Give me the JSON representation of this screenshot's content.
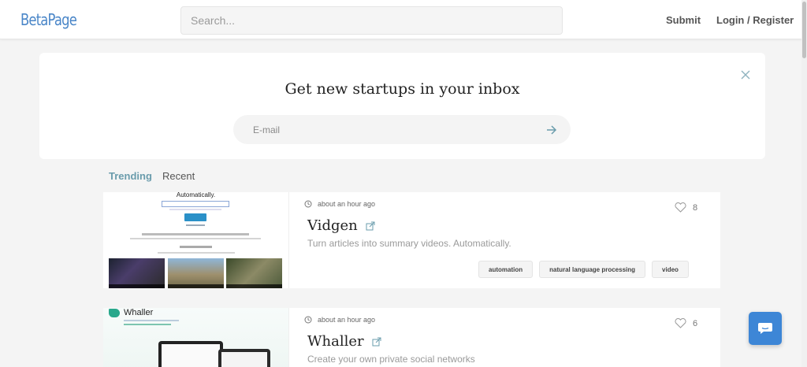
{
  "header": {
    "logo": "BetaPage",
    "search_placeholder": "Search...",
    "nav": {
      "submit": "Submit",
      "login": "Login / Register"
    }
  },
  "newsletter": {
    "title": "Get new startups in your inbox",
    "email_placeholder": "E-mail",
    "close_icon": "close-icon",
    "submit_icon": "arrow-right-icon"
  },
  "tabs": [
    {
      "label": "Trending",
      "active": true
    },
    {
      "label": "Recent",
      "active": false
    }
  ],
  "startups": [
    {
      "name": "Vidgen",
      "time": "about an hour ago",
      "description": "Turn articles into summary videos. Automatically.",
      "likes": "8",
      "tags": [
        "automation",
        "natural language processing",
        "video"
      ],
      "thumbnail": {
        "heading": "Automatically."
      }
    },
    {
      "name": "Whaller",
      "time": "about an hour ago",
      "description": "Create your own private social networks",
      "likes": "6",
      "tags": [],
      "thumbnail": {
        "logo": "Whaller"
      }
    }
  ],
  "colors": {
    "accent": "#6a9cac",
    "logo": "#4a86c8",
    "chat": "#3d86d6"
  }
}
